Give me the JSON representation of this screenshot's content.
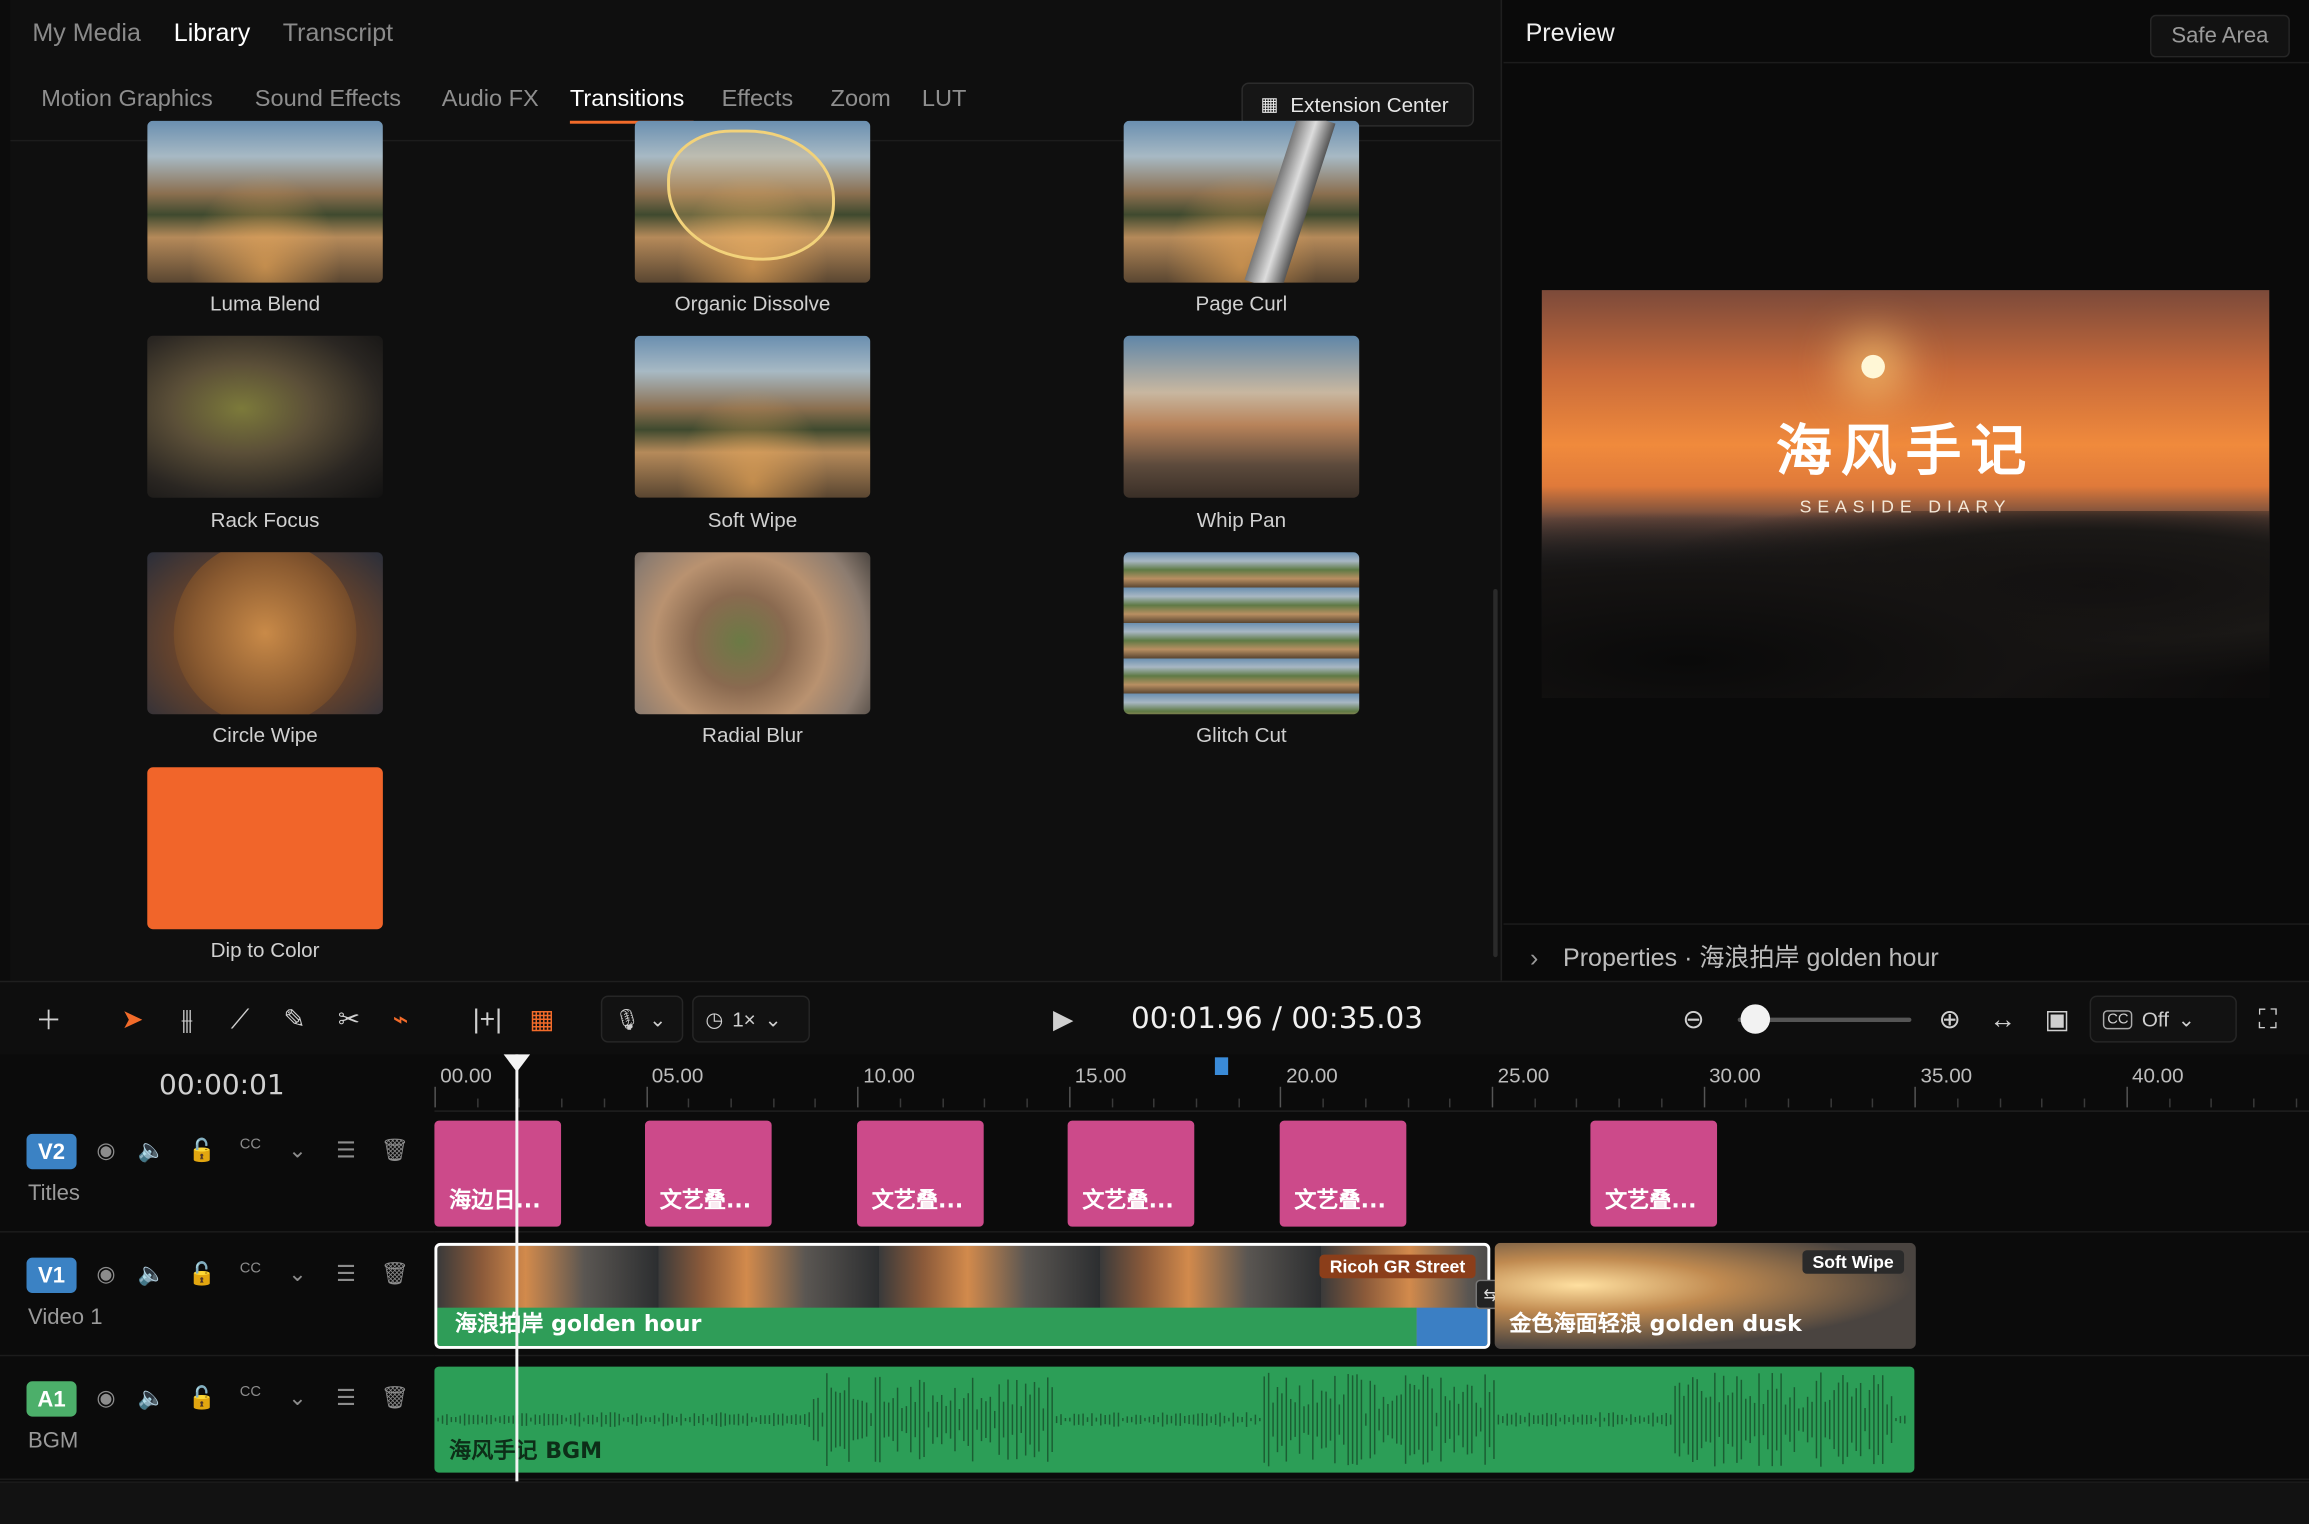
{
  "library_tabs": [
    "My Media",
    "Library",
    "Transcript"
  ],
  "library_active": "Library",
  "category_tabs": [
    "Motion Graphics",
    "Sound Effects",
    "Audio FX",
    "Transitions",
    "Effects",
    "Zoom",
    "LUT"
  ],
  "category_active": "Transitions",
  "extension_button": "Extension Center",
  "transitions": [
    {
      "label": "Luma Blend",
      "thumb": "street"
    },
    {
      "label": "Organic Dissolve",
      "thumb": "street"
    },
    {
      "label": "Page Curl",
      "thumb": "street"
    },
    {
      "label": "Rack Focus",
      "thumb": "blurA"
    },
    {
      "label": "Soft Wipe",
      "thumb": "street"
    },
    {
      "label": "Whip Pan",
      "thumb": "whip"
    },
    {
      "label": "Circle Wipe",
      "thumb": "cafe"
    },
    {
      "label": "Radial Blur",
      "thumb": "radial"
    },
    {
      "label": "Glitch Cut",
      "thumb": "glitch"
    },
    {
      "label": "Dip to Color",
      "thumb": "orange"
    }
  ],
  "preview": {
    "title": "Preview",
    "safe_area": "Safe Area",
    "video_title": "海风手记",
    "video_subtitle": "SEASIDE DIARY",
    "properties": "Properties · 海浪拍岸 golden hour"
  },
  "toolbar": {
    "speed": "1×",
    "timecode": "00:01.96 / 00:35.03",
    "captions": "Off",
    "zoom_level": 0.1
  },
  "timeline": {
    "current_time": "00:00:01",
    "ruler_labels": [
      "00.00",
      "05.00",
      "10.00",
      "15.00",
      "20.00",
      "25.00",
      "30.00",
      "35.00",
      "40.00"
    ],
    "tracks": [
      {
        "badge": "V2",
        "name": "Titles",
        "color": "#3b82c4"
      },
      {
        "badge": "V1",
        "name": "Video 1",
        "color": "#3b82c4"
      },
      {
        "badge": "A1",
        "name": "BGM",
        "color": "#4caf6a"
      }
    ],
    "title_clips": [
      "海边日...",
      "文艺叠...",
      "文艺叠...",
      "文艺叠...",
      "文艺叠...",
      "文艺叠..."
    ],
    "video_clip_1": {
      "label": "海浪拍岸 golden hour",
      "tag": "Ricoh GR Street"
    },
    "video_clip_2": {
      "label": "金色海面轻浪 golden dusk",
      "tag": "Soft Wipe"
    },
    "audio_clip": {
      "label": "海风手记 BGM"
    }
  },
  "colors": {
    "accent": "#f26b2a",
    "title_clip": "#cc4a8a",
    "audio_clip": "#2c9e57"
  }
}
